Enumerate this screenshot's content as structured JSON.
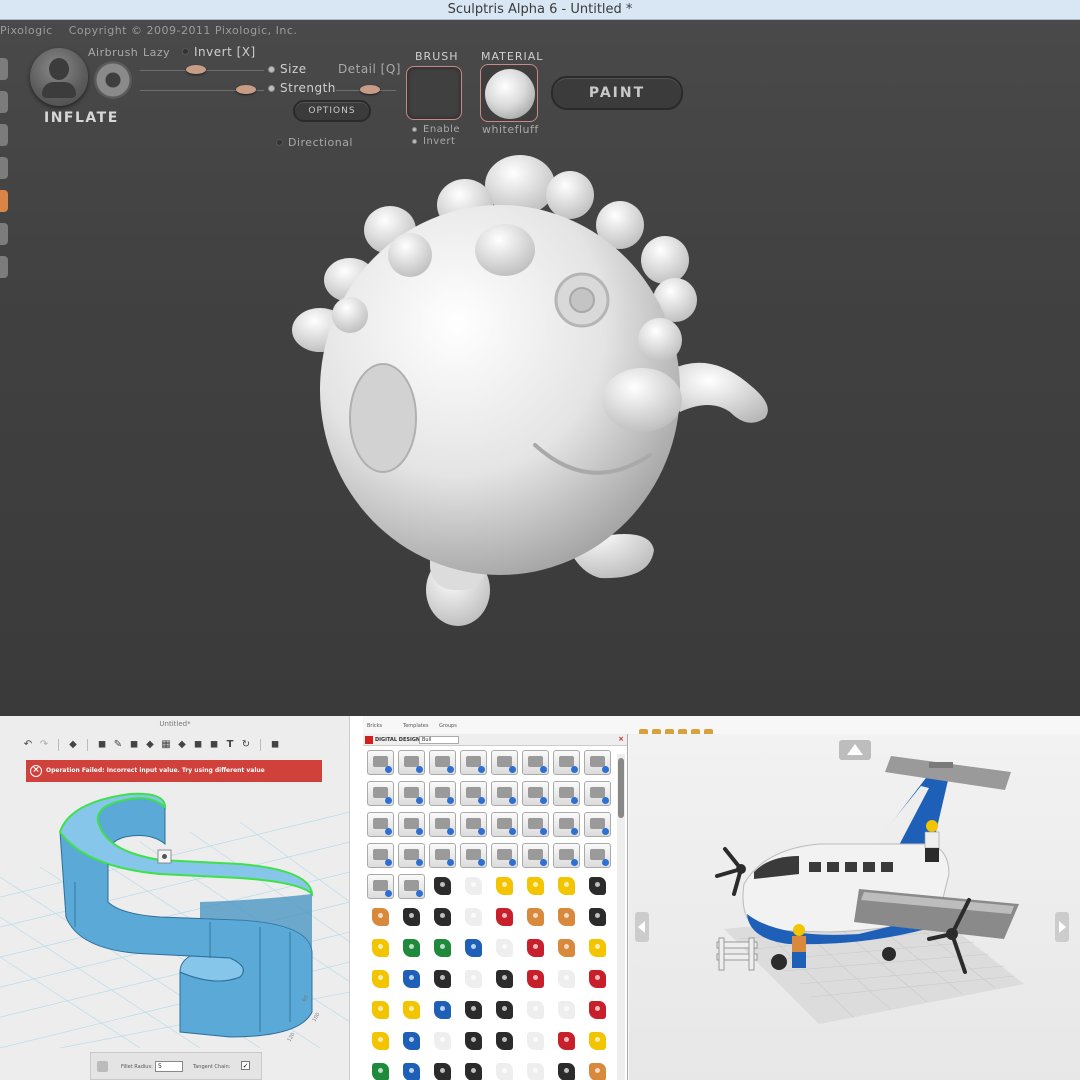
{
  "sculptris": {
    "window_title": "Sculptris Alpha 6 - Untitled *",
    "copyright_brand": "Pixologic",
    "copyright": "Copyright © 2009-2011 Pixologic, Inc.",
    "tool_name": "INFLATE",
    "airbrush_label": "Airbrush",
    "lazy_label": "Lazy",
    "invert_label": "Invert [X]",
    "size_label": "Size",
    "detail_label": "Detail [Q]",
    "strength_label": "Strength",
    "options_button": "OPTIONS",
    "directional_label": "Directional",
    "brush_header": "BRUSH",
    "enable_label": "Enable",
    "brush_invert_label": "Invert",
    "material_header": "MATERIAL",
    "material_name": "whitefluff",
    "paint_button": "PAINT",
    "colors": {
      "panel": "#414141",
      "accent": "#d98545",
      "slider_knob": "#c79d86"
    }
  },
  "design123": {
    "window_title": "Untitled*",
    "error_message": "Operation Failed: Incorrect input value. Try using different value",
    "fillet_radius_label": "Fillet Radius:",
    "fillet_radius_value": "5",
    "tangent_chain_label": "Tangent Chain:",
    "colors": {
      "error": "#d0413b",
      "model": "#5aa9d6",
      "edge_highlight": "#3fe04a"
    }
  },
  "ldd": {
    "tabs": [
      "Bricks",
      "Templates",
      "Groups"
    ],
    "palette_title": "DIGITAL DESIGNER",
    "filter_value": "Bull",
    "grey_rows": 6,
    "colors": {
      "red": "#c8202a",
      "yellow": "#f2c500",
      "blue": "#1e5fb8",
      "green": "#1f8a3b",
      "black": "#2b2b2b",
      "orange": "#d9893b",
      "white": "#eeeeee"
    }
  }
}
